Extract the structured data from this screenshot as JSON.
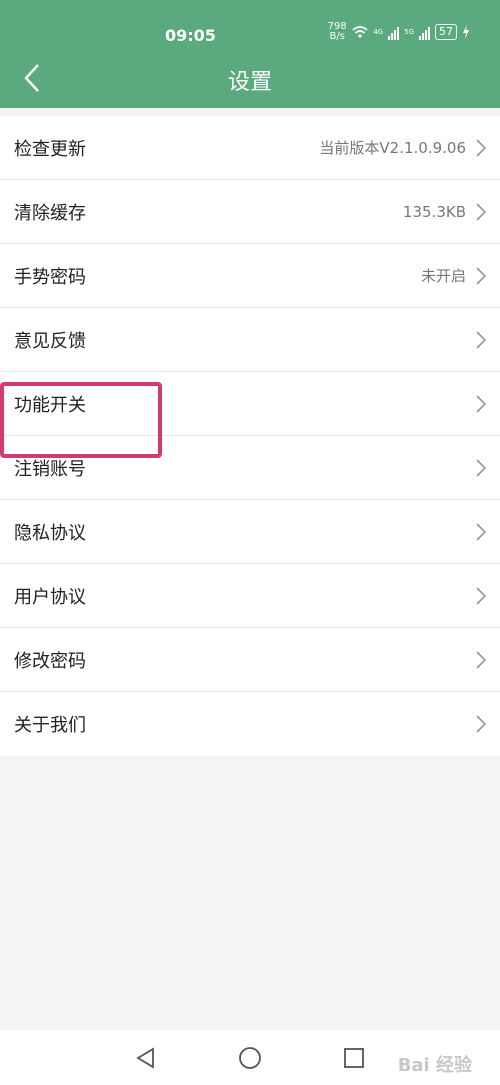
{
  "status": {
    "time": "09:05",
    "netspeed_value": "798",
    "netspeed_unit": "B/s",
    "sim1_label": "4G",
    "sim2_label": "5G",
    "battery": "57"
  },
  "header": {
    "title": "设置",
    "back_icon": "chevron-left-icon"
  },
  "settings": [
    {
      "label": "检查更新",
      "value": "当前版本V2.1.0.9.06"
    },
    {
      "label": "清除缓存",
      "value": "135.3KB"
    },
    {
      "label": "手势密码",
      "value": "未开启"
    },
    {
      "label": "意见反馈",
      "value": ""
    },
    {
      "label": "功能开关",
      "value": ""
    },
    {
      "label": "注销账号",
      "value": ""
    },
    {
      "label": "隐私协议",
      "value": ""
    },
    {
      "label": "用户协议",
      "value": ""
    },
    {
      "label": "修改密码",
      "value": ""
    },
    {
      "label": "关于我们",
      "value": ""
    }
  ],
  "highlight_color": "#d33a72",
  "accent_color": "#5aa97f",
  "watermark": "Bai 经验"
}
